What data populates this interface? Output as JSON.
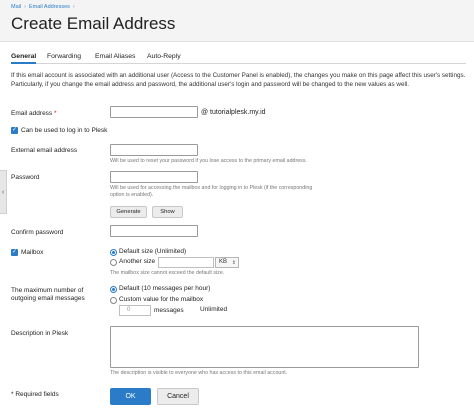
{
  "breadcrumb": [
    "Mail",
    "Email Addresses"
  ],
  "page_title": "Create Email Address",
  "tabs": [
    "General",
    "Forwarding",
    "Email Aliases",
    "Auto-Reply"
  ],
  "intro": "If this email account is associated with an additional user (Access to the Customer Panel is enabled), the changes you make on this page affect this user's settings. Particularly, if you change the email address and password, the additional user's login and password will be changed to the new values as well.",
  "email": {
    "label": "Email address",
    "required_mark": "*",
    "value": "",
    "domain": "@ tutorialplesk.my.id"
  },
  "login_checkbox": {
    "label": "Can be used to log in to Plesk",
    "checked": true
  },
  "external_email": {
    "label": "External email address",
    "value": "",
    "hint": "Will be used to reset your password if you lose access to the primary email address."
  },
  "password": {
    "label": "Password",
    "value": "",
    "hint_line1": "Will be used for accessing the mailbox and for logging in to Plesk (if the corresponding",
    "hint_line2": "option is enabled).",
    "generate_label": "Generate",
    "show_label": "Show"
  },
  "confirm_password": {
    "label": "Confirm password",
    "value": ""
  },
  "mailbox": {
    "label": "Mailbox",
    "checked": true,
    "option_default": "Default size (Unlimited)",
    "option_another": "Another size",
    "size_value": "",
    "unit": "KB",
    "hint": "The mailbox size cannot exceed the default size."
  },
  "max_messages": {
    "label_line1": "The maximum number of",
    "label_line2": "outgoing email messages",
    "option_default": "Default (10 messages per hour)",
    "option_custom": "Custom value for the mailbox",
    "count_placeholder": "0",
    "unit_label": "messages",
    "unlimited_label": "Unlimited"
  },
  "description": {
    "label": "Description in Plesk",
    "value": "",
    "hint": "The description is visible to everyone who has access to this email account."
  },
  "required_note": "* Required fields",
  "buttons": {
    "ok": "OK",
    "cancel": "Cancel"
  },
  "icons": {
    "collapse_handle": "chevron-left-icon",
    "checkbox_check": "checkmark-icon",
    "select_arrow": "updown-arrows-icon"
  },
  "colors": {
    "accent": "#2a7cc8",
    "required": "#d02020",
    "header_bg": "#f4f4f4"
  }
}
